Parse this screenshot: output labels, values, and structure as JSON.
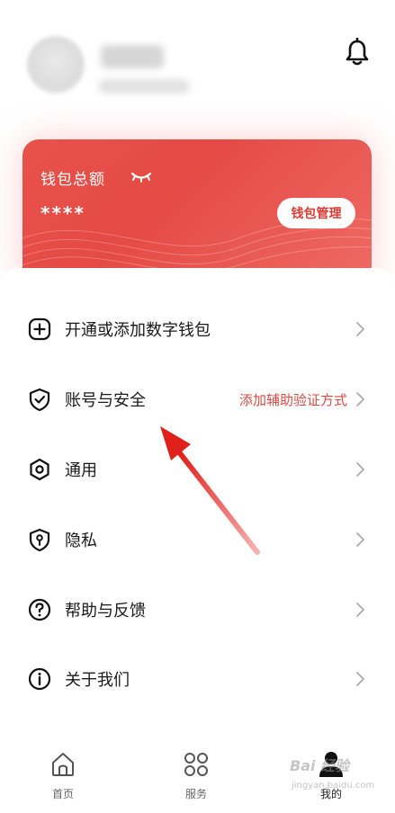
{
  "header": {
    "notification_icon": "bell-icon"
  },
  "wallet": {
    "title": "钱包总额",
    "amount_masked": "****",
    "manage_button": "钱包管理",
    "visibility_icon": "eye-closed-icon",
    "accent_color": "#e54a45"
  },
  "menu": {
    "items": [
      {
        "label": "开通或添加数字钱包",
        "hint": "",
        "icon": "plus-circle-icon"
      },
      {
        "label": "账号与安全",
        "hint": "添加辅助验证方式",
        "icon": "shield-check-icon"
      },
      {
        "label": "通用",
        "hint": "",
        "icon": "hexagon-settings-icon"
      },
      {
        "label": "隐私",
        "hint": "",
        "icon": "privacy-shield-icon"
      },
      {
        "label": "帮助与反馈",
        "hint": "",
        "icon": "help-circle-icon"
      },
      {
        "label": "关于我们",
        "hint": "",
        "icon": "info-circle-icon"
      }
    ]
  },
  "bottom_nav": {
    "items": [
      {
        "label": "首页",
        "icon": "home-icon",
        "active": false
      },
      {
        "label": "服务",
        "icon": "grid-icon",
        "active": false
      },
      {
        "label": "我的",
        "icon": "person-icon",
        "active": true
      }
    ]
  },
  "watermark": {
    "text": "Bai 经验",
    "sub": "jingyan.baidu.com"
  }
}
